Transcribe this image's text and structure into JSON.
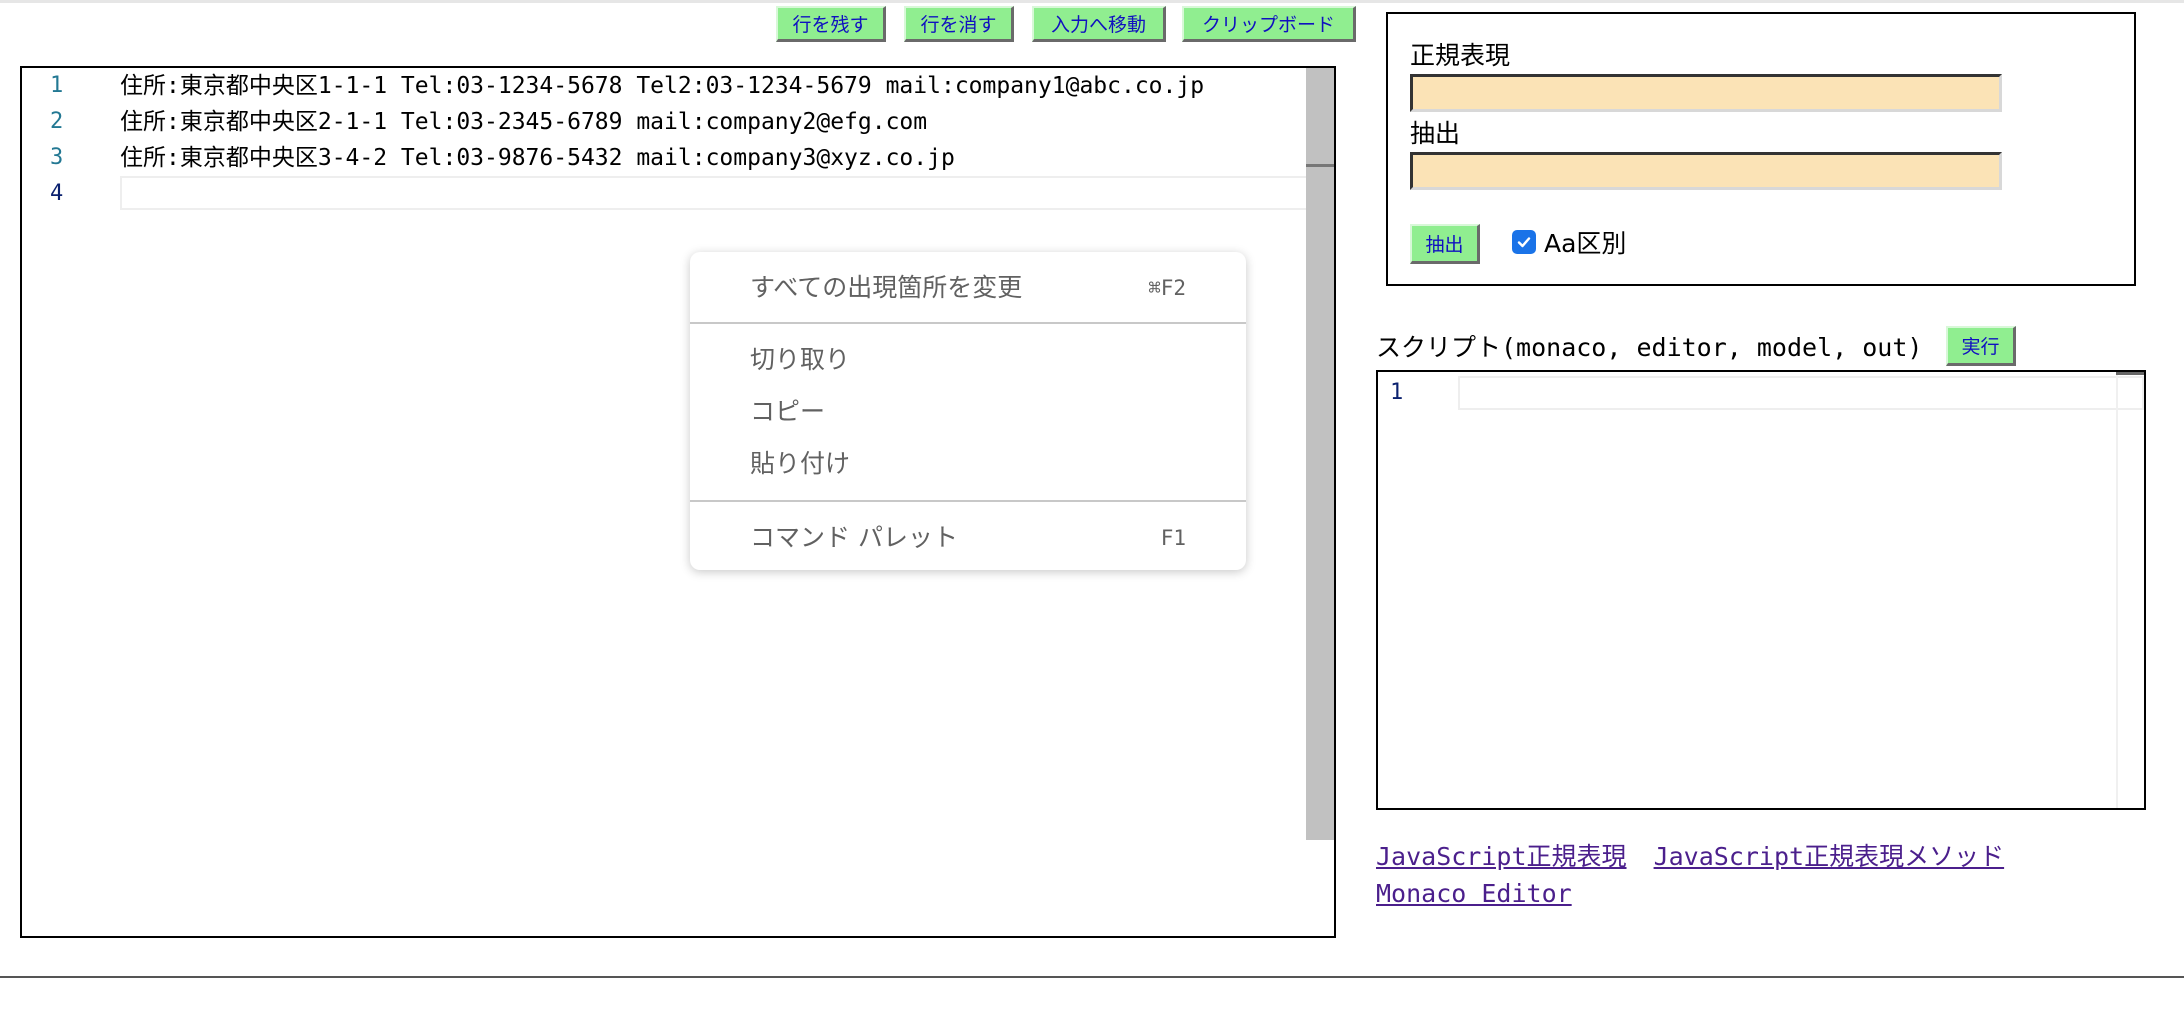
{
  "toolbar": {
    "keep_lines": "行を残す",
    "delete_lines": "行を消す",
    "move_to_input": "入力へ移動",
    "clipboard": "クリップボード"
  },
  "editor": {
    "lines": [
      {
        "number": "1",
        "text": "住所:東京都中央区1-1-1 Tel:03-1234-5678 Tel2:03-1234-5679 mail:company1@abc.co.jp"
      },
      {
        "number": "2",
        "text": "住所:東京都中央区2-1-1 Tel:03-2345-6789 mail:company2@efg.com"
      },
      {
        "number": "3",
        "text": "住所:東京都中央区3-4-2 Tel:03-9876-5432 mail:company3@xyz.co.jp"
      },
      {
        "number": "4",
        "text": ""
      }
    ]
  },
  "context_menu": {
    "change_all": {
      "label": "すべての出現箇所を変更",
      "shortcut": "⌘F2"
    },
    "cut": {
      "label": "切り取り"
    },
    "copy": {
      "label": "コピー"
    },
    "paste": {
      "label": "貼り付け"
    },
    "command_palette": {
      "label": "コマンド パレット",
      "shortcut": "F1"
    }
  },
  "regex_panel": {
    "regex_label": "正規表現",
    "regex_value": "",
    "extract_label": "抽出",
    "extract_value": "",
    "extract_button": "抽出",
    "case_label": "Aa区別",
    "case_checked": true
  },
  "script": {
    "label": "スクリプト(monaco, editor, model, out)",
    "run_button": "実行",
    "line_number": "1"
  },
  "links": {
    "regex": "JavaScript正規表現",
    "regex_methods": "JavaScript正規表現メソッド",
    "monaco": "Monaco Editor"
  },
  "colors": {
    "button_bg": "#90ee90",
    "button_text": "#1010c0",
    "input_bg": "#fbe3b6",
    "line_number": "#237893",
    "link": "#4b1f8c"
  }
}
